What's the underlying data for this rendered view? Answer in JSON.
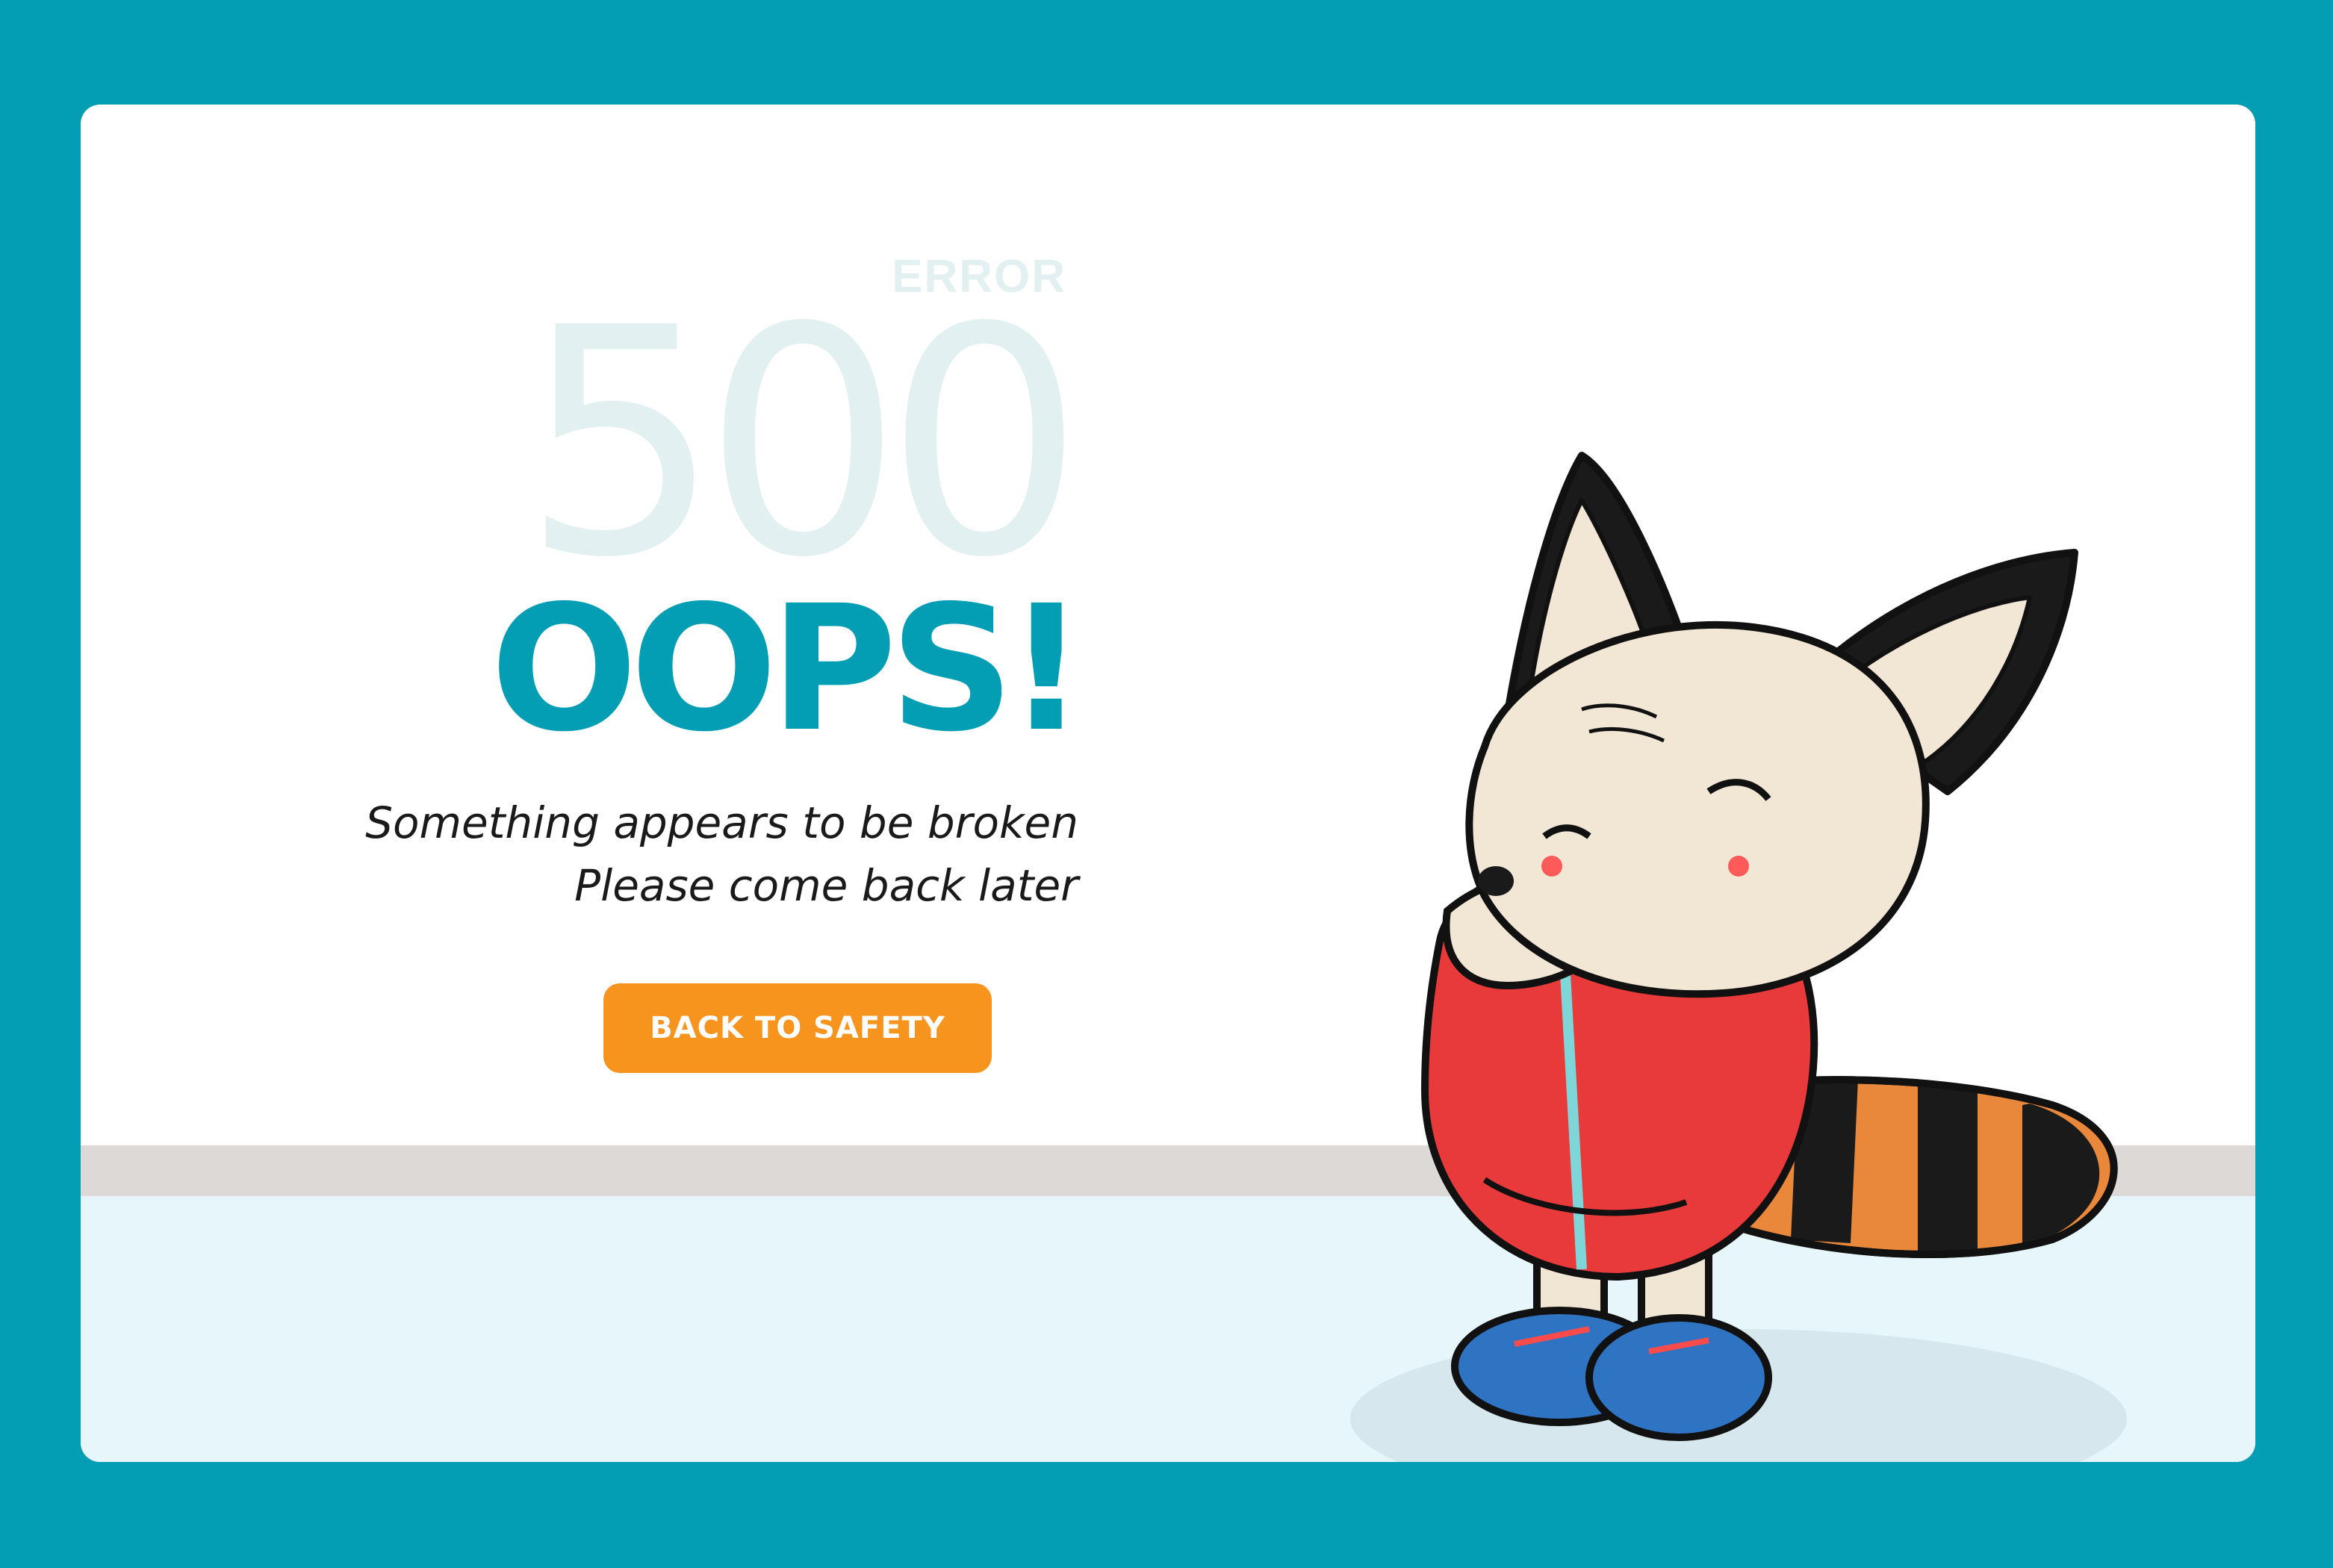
{
  "error": {
    "label": "ERROR",
    "code": "500",
    "headline": "OOPS!",
    "message_line1": "Something appears to be broken",
    "message_line2": "Please come back later"
  },
  "cta": {
    "label": "BACK TO SAFETY"
  },
  "colors": {
    "frame": "#039db4",
    "card": "#ffffff",
    "headline": "#039db4",
    "code": "#e3f0f1",
    "button": "#f7941d",
    "wall_strip": "#dcd9d6",
    "floor": "#e7f6fa"
  },
  "illustration": {
    "name": "red-panda-mascot"
  }
}
